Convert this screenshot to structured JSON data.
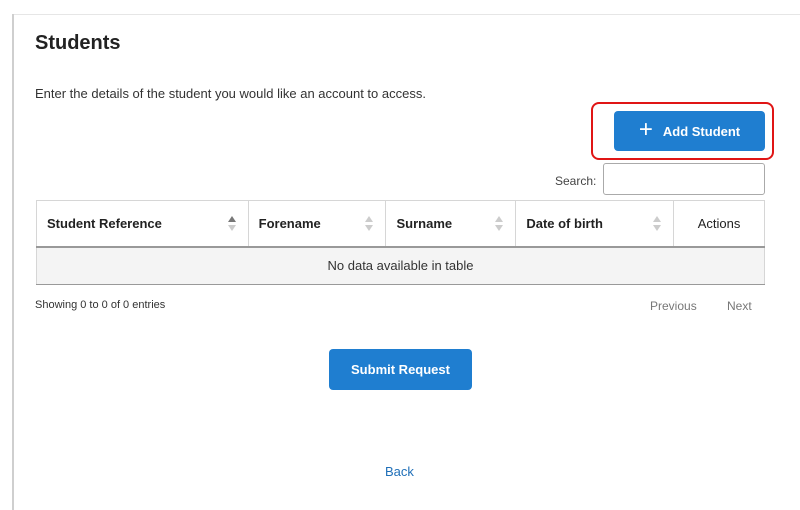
{
  "header": {
    "title": "Students"
  },
  "intro": "Enter the details of the student you would like an account to access.",
  "toolbar": {
    "add_student_label": "Add Student",
    "plus_glyph": "+"
  },
  "search": {
    "label": "Search:",
    "value": "",
    "placeholder": ""
  },
  "table": {
    "columns": [
      {
        "label": "Student Reference",
        "sort": "ascending"
      },
      {
        "label": "Forename",
        "sort": "none"
      },
      {
        "label": "Surname",
        "sort": "none"
      },
      {
        "label": "Date of birth",
        "sort": "none"
      },
      {
        "label": "Actions"
      }
    ],
    "empty_message": "No data available in table"
  },
  "pagination": {
    "info": "Showing 0 to 0 of 0 entries",
    "previous_label": "Previous",
    "next_label": "Next"
  },
  "actions": {
    "submit_label": "Submit Request",
    "back_label": "Back"
  },
  "colors": {
    "primary": "#1f7ed0",
    "highlight": "#e01515",
    "link": "#1f6fb8"
  }
}
